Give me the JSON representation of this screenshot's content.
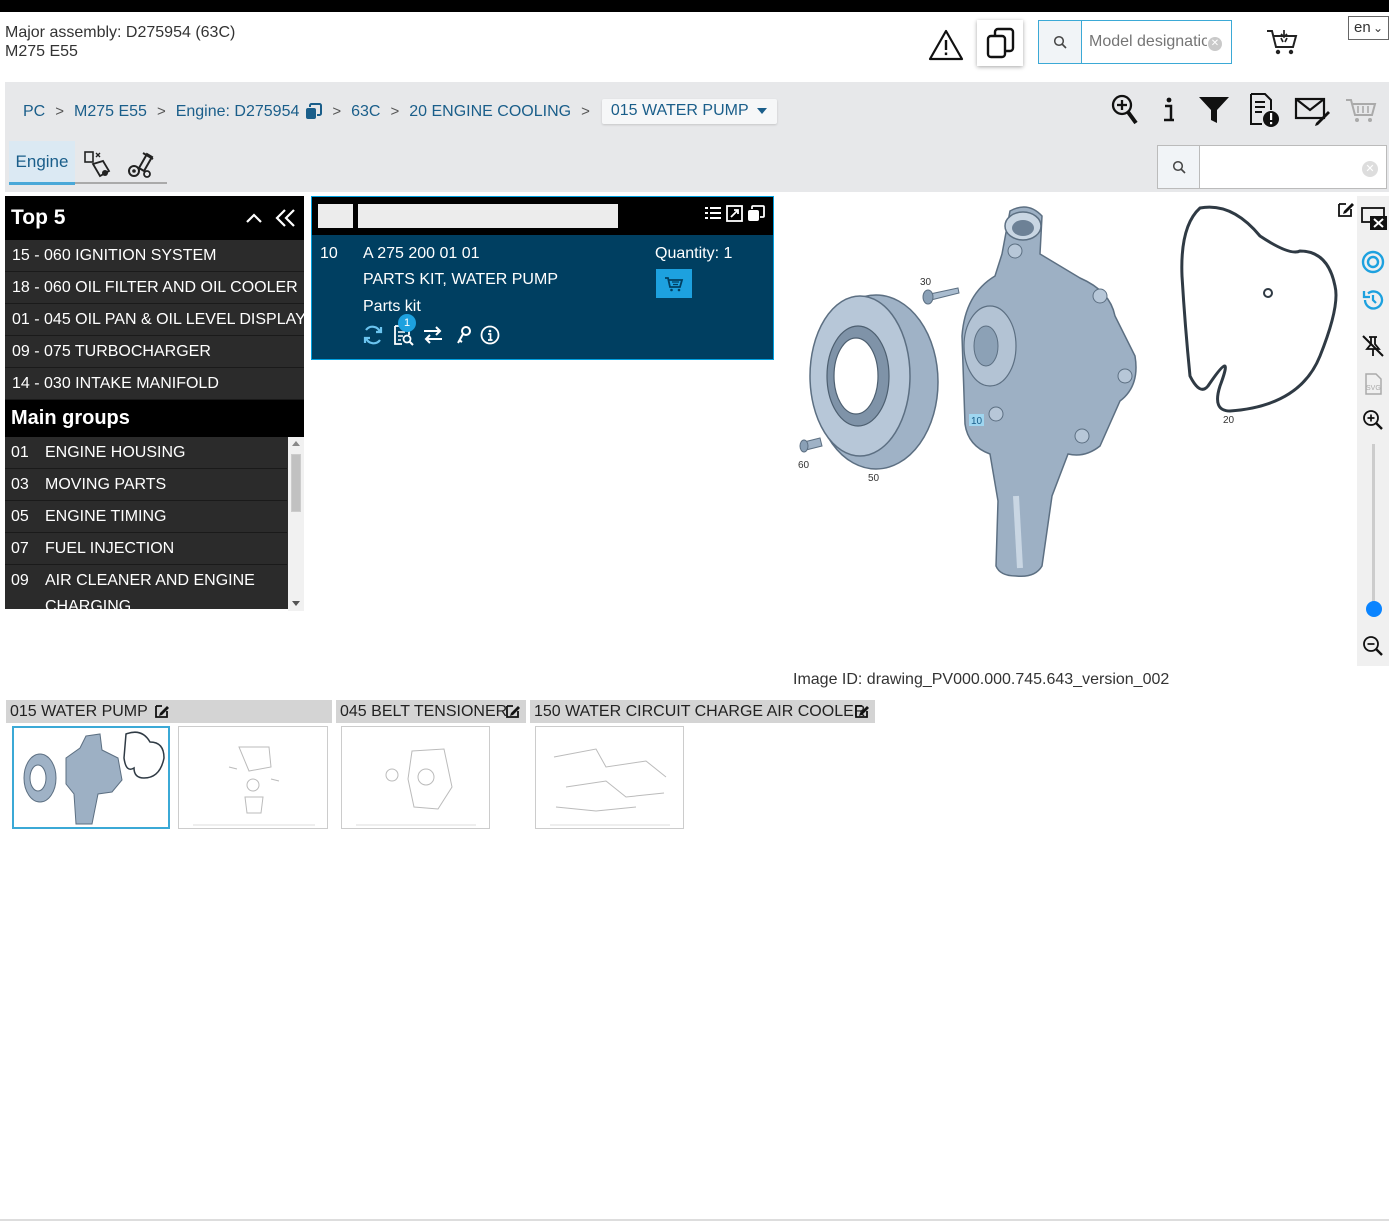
{
  "header": {
    "major_assembly": "Major assembly: D275954 (63C)",
    "model": "M275 E55",
    "model_search_placeholder": "Model designation",
    "language": "en"
  },
  "breadcrumb": {
    "items": [
      "PC",
      "M275 E55",
      "Engine: D275954",
      "63C",
      "20 ENGINE COOLING"
    ],
    "current": "015 WATER PUMP"
  },
  "subtabs": {
    "engine_label": "Engine"
  },
  "top5": {
    "title": "Top 5",
    "items": [
      "15 - 060 IGNITION SYSTEM",
      "18 - 060 OIL FILTER AND OIL COOLER",
      "01 - 045 OIL PAN & OIL LEVEL DISPLAY",
      "09 - 075 TURBOCHARGER",
      "14 - 030 INTAKE MANIFOLD"
    ]
  },
  "main_groups": {
    "title": "Main groups",
    "items": [
      {
        "num": "01",
        "label": "ENGINE HOUSING"
      },
      {
        "num": "03",
        "label": "MOVING PARTS"
      },
      {
        "num": "05",
        "label": "ENGINE TIMING"
      },
      {
        "num": "07",
        "label": "FUEL INJECTION"
      },
      {
        "num": "09",
        "label": "AIR CLEANER AND ENGINE CHARGING"
      }
    ]
  },
  "part": {
    "position": "10",
    "number": "A 275 200 01 01",
    "description": "PARTS KIT, WATER PUMP",
    "type": "Parts kit",
    "quantity": "Quantity: 1",
    "badge": "1"
  },
  "drawing": {
    "callouts": [
      "30",
      "20",
      "10",
      "60",
      "50"
    ],
    "image_id": "Image ID: drawing_PV000.000.745.643_version_002"
  },
  "thumbnail_tabs": [
    "015 WATER PUMP",
    "045 BELT TENSIONER",
    "150 WATER CIRCUIT CHARGE AIR COOLER"
  ],
  "colors": {
    "accent": "#1da1df",
    "part_panel": "#003f61",
    "link": "#1a5e8a",
    "panel_dark": "#2b2b2b"
  }
}
